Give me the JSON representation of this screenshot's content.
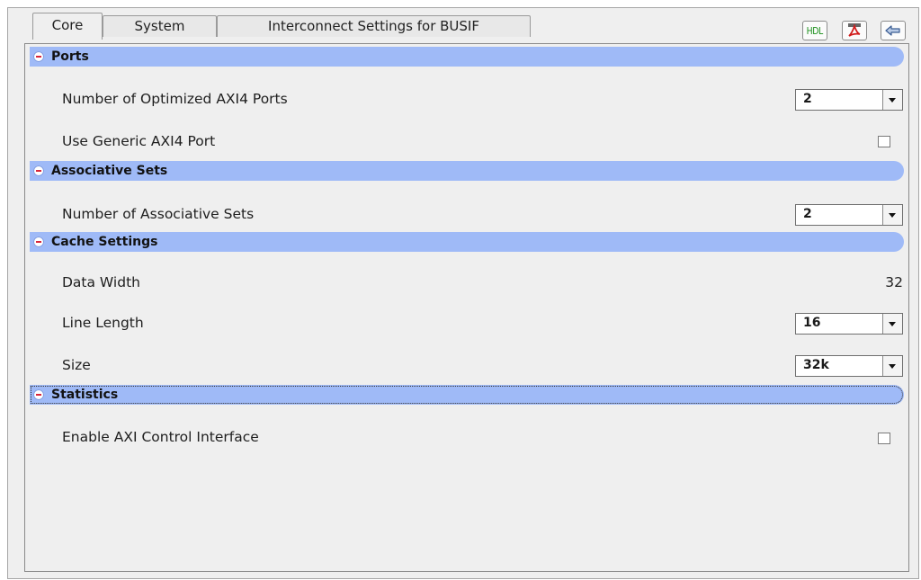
{
  "tabs": [
    {
      "label": "Core",
      "active": true
    },
    {
      "label": "System",
      "active": false
    },
    {
      "label": "Interconnect Settings for BUSIF",
      "active": false
    }
  ],
  "toolbar": {
    "hdl_label": "HDL",
    "pdf_icon": "pdf-icon",
    "back_icon": "back-arrow-icon",
    "hdl_color": "#1a8f1a"
  },
  "sections": {
    "ports": {
      "title": "Ports",
      "num_ports_label": "Number of Optimized AXI4 Ports",
      "num_ports_value": "2",
      "generic_port_label": "Use Generic AXI4 Port",
      "generic_port_checked": false
    },
    "assoc": {
      "title": "Associative Sets",
      "num_sets_label": "Number of Associative Sets",
      "num_sets_value": "2"
    },
    "cache": {
      "title": "Cache Settings",
      "data_width_label": "Data Width",
      "data_width_value": "32",
      "line_length_label": "Line Length",
      "line_length_value": "16",
      "size_label": "Size",
      "size_value": "32k"
    },
    "stats": {
      "title": "Statistics",
      "axi_ctrl_label": "Enable AXI Control Interface",
      "axi_ctrl_checked": false
    }
  },
  "colors": {
    "section_header": "#9fbaf7",
    "panel_background": "#efefef"
  }
}
